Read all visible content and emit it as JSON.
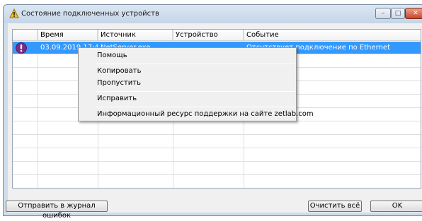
{
  "window": {
    "title": "Состояние подключенных устройств",
    "controls": {
      "minimize": "–",
      "maximize": "□",
      "close": "✕"
    }
  },
  "table": {
    "columns": [
      "Время",
      "Источник",
      "Устройство",
      "Событие"
    ],
    "rows": [
      {
        "icon": "exclamation-icon",
        "time": "03.09.2019 17:46:23",
        "source": "NetServer.exe",
        "device": "",
        "event": "Отсутствует подключение по Ethernet"
      }
    ]
  },
  "buttons": {
    "send_log": "Отправить в журнал ошибок",
    "clear_all": "Очистить всё",
    "ok": "OK"
  },
  "context_menu": {
    "items": [
      "Помощь",
      "Копировать",
      "Пропустить",
      "Исправить",
      "Информационный ресурс поддержки на сайте zetlab.com"
    ]
  },
  "colors": {
    "selection": "#3399ff",
    "row_icon": "#7b2a8a"
  }
}
